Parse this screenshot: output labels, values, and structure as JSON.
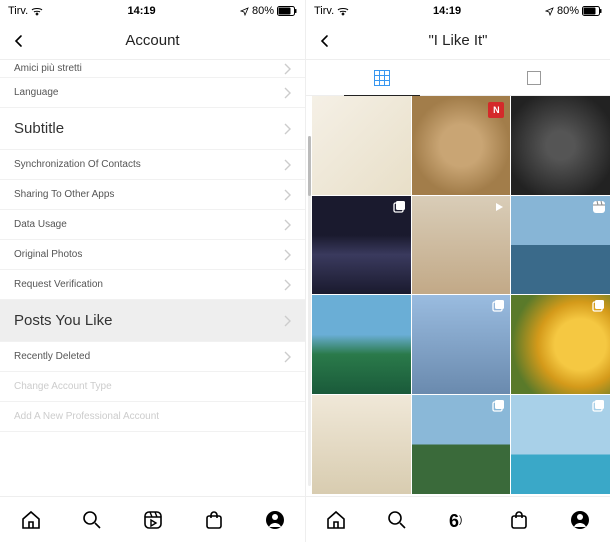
{
  "left": {
    "status": {
      "carrier": "Tirv.",
      "time": "14:19",
      "battery": "80%"
    },
    "header": {
      "title": "Account"
    },
    "rows": [
      {
        "label": "Amici più stretti",
        "size": "small"
      },
      {
        "label": "Language",
        "size": "small"
      },
      {
        "label": "Subtitle",
        "size": "big"
      },
      {
        "label": "Synchronization Of Contacts",
        "size": "small"
      },
      {
        "label": "Sharing To Other Apps",
        "size": "small"
      },
      {
        "label": "Data Usage",
        "size": "small"
      },
      {
        "label": "Original Photos",
        "size": "small"
      },
      {
        "label": "Request Verification",
        "size": "small"
      },
      {
        "label": "Posts You Like",
        "size": "big",
        "highlight": true
      },
      {
        "label": "Recently Deleted",
        "size": "small"
      },
      {
        "label": "Change Account Type",
        "size": "small",
        "faded": true
      },
      {
        "label": "Add A New Professional Account",
        "size": "small",
        "faded": true
      }
    ]
  },
  "right": {
    "status": {
      "carrier": "Tirv.",
      "time": "14:19",
      "battery": "80%"
    },
    "header": {
      "title": "\"I Like It\""
    },
    "tabs": {
      "grid_active": true
    },
    "tiles": [
      {
        "class": "t1",
        "badge": null
      },
      {
        "class": "t2",
        "badge": "red"
      },
      {
        "class": "t3",
        "badge": null
      },
      {
        "class": "t4",
        "badge": "multi"
      },
      {
        "class": "t5",
        "badge": "video"
      },
      {
        "class": "t6",
        "badge": "reel"
      },
      {
        "class": "t7",
        "badge": null
      },
      {
        "class": "t8",
        "badge": "multi"
      },
      {
        "class": "t9",
        "badge": "multi"
      },
      {
        "class": "t10",
        "badge": null
      },
      {
        "class": "t11",
        "badge": "multi"
      },
      {
        "class": "t12",
        "badge": "multi"
      }
    ]
  },
  "nav": {
    "items": [
      "home",
      "search",
      "reels",
      "shop",
      "profile"
    ]
  }
}
